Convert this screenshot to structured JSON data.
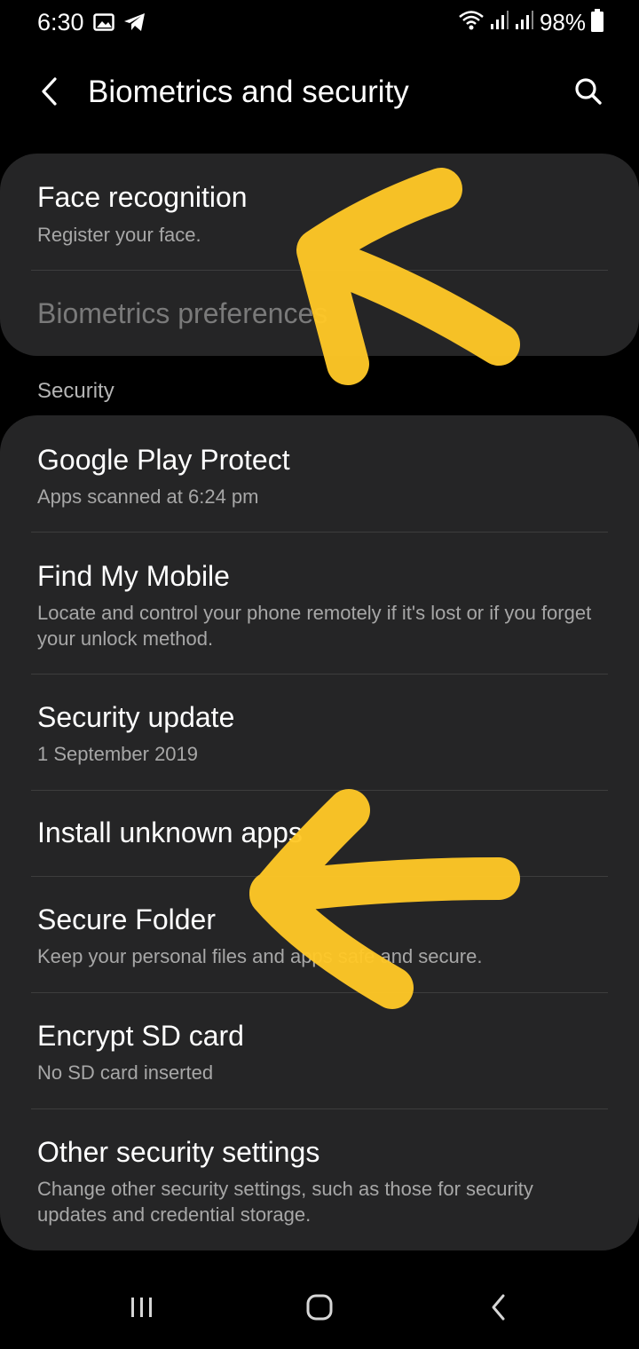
{
  "status_bar": {
    "time": "6:30",
    "battery": "98%",
    "icons_left": [
      "image-icon",
      "telegram-icon"
    ],
    "icons_right": [
      "wifi-icon",
      "signal-icon",
      "signal-icon",
      "battery-icon"
    ]
  },
  "header": {
    "title": "Biometrics and security",
    "back_icon": "back-arrow-icon",
    "search_icon": "search-icon"
  },
  "biometrics": {
    "items": [
      {
        "title": "Face recognition",
        "subtitle": "Register your face."
      },
      {
        "title": "Biometrics preferences",
        "subtitle": ""
      }
    ]
  },
  "security": {
    "header": "Security",
    "items": [
      {
        "title": "Google Play Protect",
        "subtitle": "Apps scanned at 6:24 pm"
      },
      {
        "title": "Find My Mobile",
        "subtitle": "Locate and control your phone remotely if it's lost or if you forget your unlock method."
      },
      {
        "title": "Security update",
        "subtitle": "1 September 2019"
      },
      {
        "title": "Install unknown apps",
        "subtitle": ""
      },
      {
        "title": "Secure Folder",
        "subtitle": "Keep your personal files and apps safe and secure."
      },
      {
        "title": "Encrypt SD card",
        "subtitle": "No SD card inserted"
      },
      {
        "title": "Other security settings",
        "subtitle": "Change other security settings, such as those for security updates and credential storage."
      }
    ]
  },
  "nav_bar": {
    "icons": [
      "recents-icon",
      "home-icon",
      "back-icon"
    ]
  },
  "colors": {
    "background": "#000000",
    "card": "#252526",
    "annotation": "#ffc826"
  }
}
